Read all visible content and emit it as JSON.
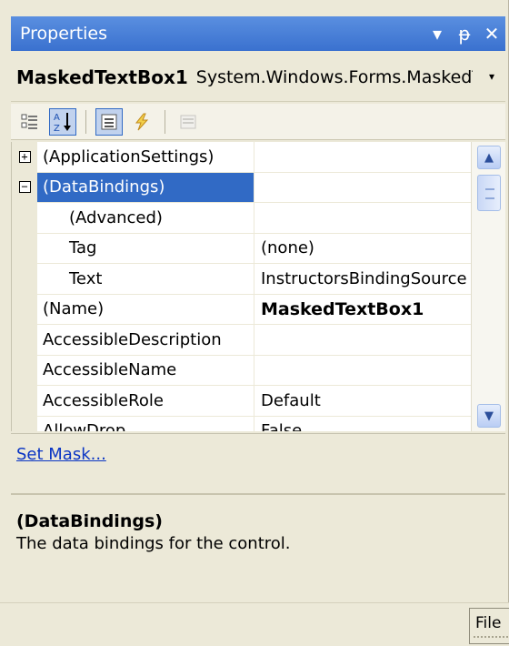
{
  "titlebar": {
    "title": "Properties",
    "pin_glyph": "▾",
    "autohide_glyph": "ᵽ",
    "close_glyph": "✕"
  },
  "selector": {
    "object_name": "MaskedTextBox1",
    "object_type": "System.Windows.Forms.MaskedTextBox",
    "dropdown_glyph": "▾"
  },
  "toolbar": {
    "icons": [
      "categorized-icon",
      "alphabetical-icon",
      "properties-icon",
      "events-icon",
      "property-pages-icon"
    ]
  },
  "grid": {
    "rows": [
      {
        "name": "(ApplicationSettings)",
        "value": "",
        "expander": "⊞"
      },
      {
        "name": "(DataBindings)",
        "value": "",
        "expander": "⊟"
      },
      {
        "name": "(Advanced)",
        "value": ""
      },
      {
        "name": "Tag",
        "value": "(none)"
      },
      {
        "name": "Text",
        "value": "InstructorsBindingSource - Name"
      },
      {
        "name": "(Name)",
        "value": "MaskedTextBox1"
      },
      {
        "name": "AccessibleDescription",
        "value": ""
      },
      {
        "name": "AccessibleName",
        "value": ""
      },
      {
        "name": "AccessibleRole",
        "value": "Default"
      },
      {
        "name": "AllowDrop",
        "value": "False"
      }
    ]
  },
  "commands": {
    "link": "Set Mask..."
  },
  "description": {
    "title": "(DataBindings)",
    "text": "The data bindings for the control."
  },
  "bottom": {
    "tab_label": "File"
  },
  "colors": {
    "title_gradient_top": "#5a8fe0",
    "title_gradient_bottom": "#3a71cf",
    "selection": "#316ac5",
    "chrome": "#ece9d8",
    "link": "#0a35c4"
  }
}
